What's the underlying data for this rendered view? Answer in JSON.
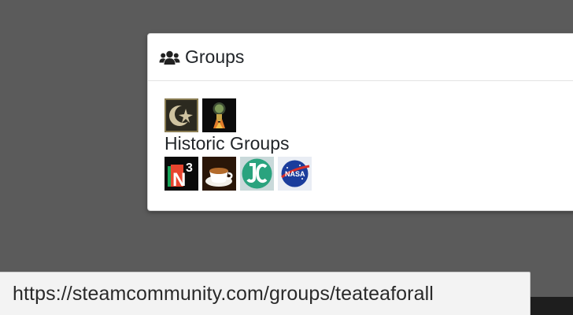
{
  "panel": {
    "title": "Groups",
    "header_icon": "users-icon"
  },
  "groups": {
    "current": [
      {
        "name": "group-icon-crescent-star",
        "icon": "crescent-star-icon"
      },
      {
        "name": "group-icon-rocket-bot",
        "icon": "rocket-bot-icon"
      }
    ],
    "historic_label": "Historic Groups",
    "historic": [
      {
        "name": "group-icon-n3",
        "icon": "n3-logo-icon"
      },
      {
        "name": "group-icon-teacup",
        "icon": "teacup-icon"
      },
      {
        "name": "group-icon-jc",
        "icon": "jc-logo-icon"
      },
      {
        "name": "group-icon-nasa",
        "icon": "nasa-logo-icon"
      }
    ]
  },
  "status_bar": {
    "url": "https://steamcommunity.com/groups/teateaforall"
  },
  "colors": {
    "backdrop": "#5b5b5b",
    "panel_bg": "#ffffff",
    "text": "#212529"
  }
}
